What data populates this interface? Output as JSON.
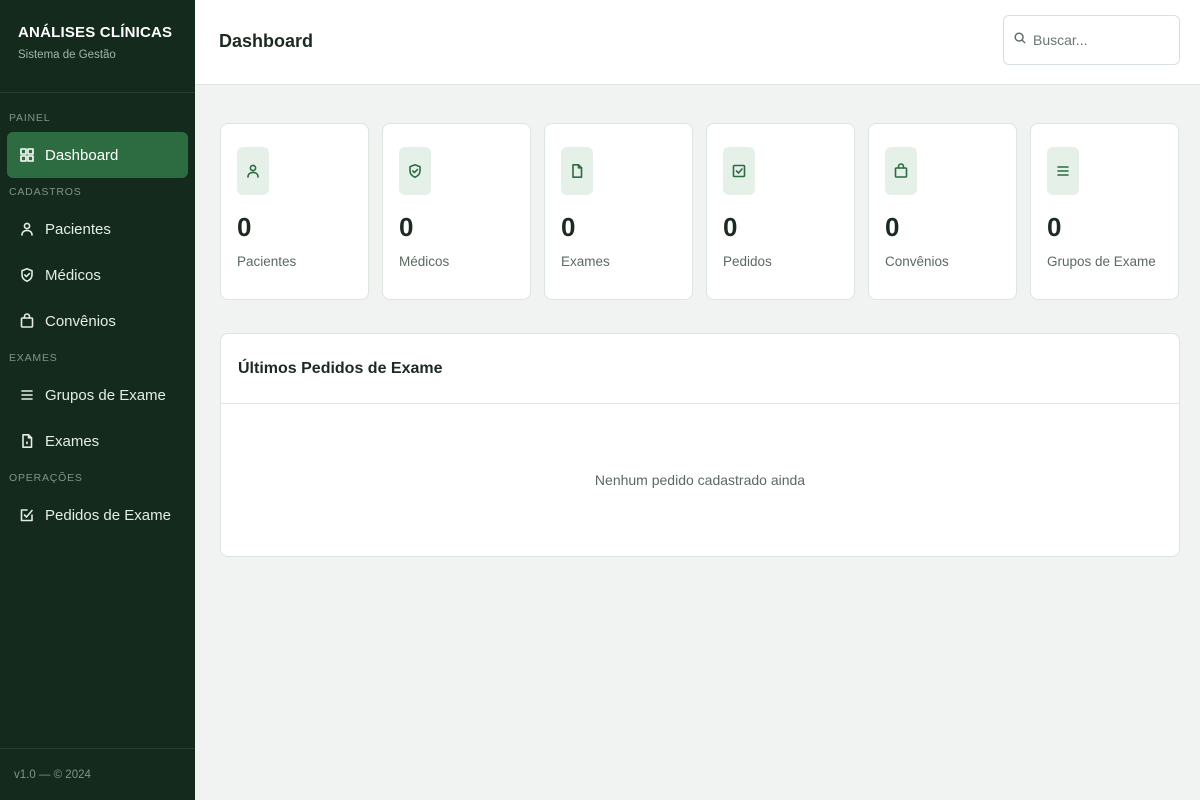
{
  "brand": {
    "title": "ANÁLISES CLÍNICAS",
    "subtitle": "Sistema de Gestão"
  },
  "sidebar": {
    "sections": [
      {
        "label": "PAINEL",
        "items": [
          {
            "label": "Dashboard",
            "icon": "grid-icon",
            "active": true
          }
        ]
      },
      {
        "label": "CADASTROS",
        "items": [
          {
            "label": "Pacientes",
            "icon": "user-icon"
          },
          {
            "label": "Médicos",
            "icon": "shield-check-icon"
          },
          {
            "label": "Convênios",
            "icon": "bag-icon"
          }
        ]
      },
      {
        "label": "EXAMES",
        "items": [
          {
            "label": "Grupos de Exame",
            "icon": "list-icon"
          },
          {
            "label": "Exames",
            "icon": "file-icon"
          }
        ]
      },
      {
        "label": "OPERAÇÕES",
        "items": [
          {
            "label": "Pedidos de Exame",
            "icon": "clipboard-check-icon"
          }
        ]
      }
    ],
    "footer": "v1.0 — © 2024"
  },
  "header": {
    "title": "Dashboard",
    "search_placeholder": "Buscar..."
  },
  "stats": [
    {
      "value": "0",
      "label": "Pacientes",
      "icon": "user-icon"
    },
    {
      "value": "0",
      "label": "Médicos",
      "icon": "shield-check-icon"
    },
    {
      "value": "0",
      "label": "Exames",
      "icon": "file-icon"
    },
    {
      "value": "0",
      "label": "Pedidos",
      "icon": "clipboard-check-icon"
    },
    {
      "value": "0",
      "label": "Convênios",
      "icon": "bag-icon"
    },
    {
      "value": "0",
      "label": "Grupos de Exame",
      "icon": "list-icon"
    }
  ],
  "recent_orders": {
    "title": "Últimos Pedidos de Exame",
    "empty_message": "Nenhum pedido cadastrado ainda"
  },
  "colors": {
    "sidebar_bg": "#142a1c",
    "accent": "#2d6b40",
    "page_bg": "#f0f3f1",
    "icon_bg": "#e5f0e8"
  }
}
